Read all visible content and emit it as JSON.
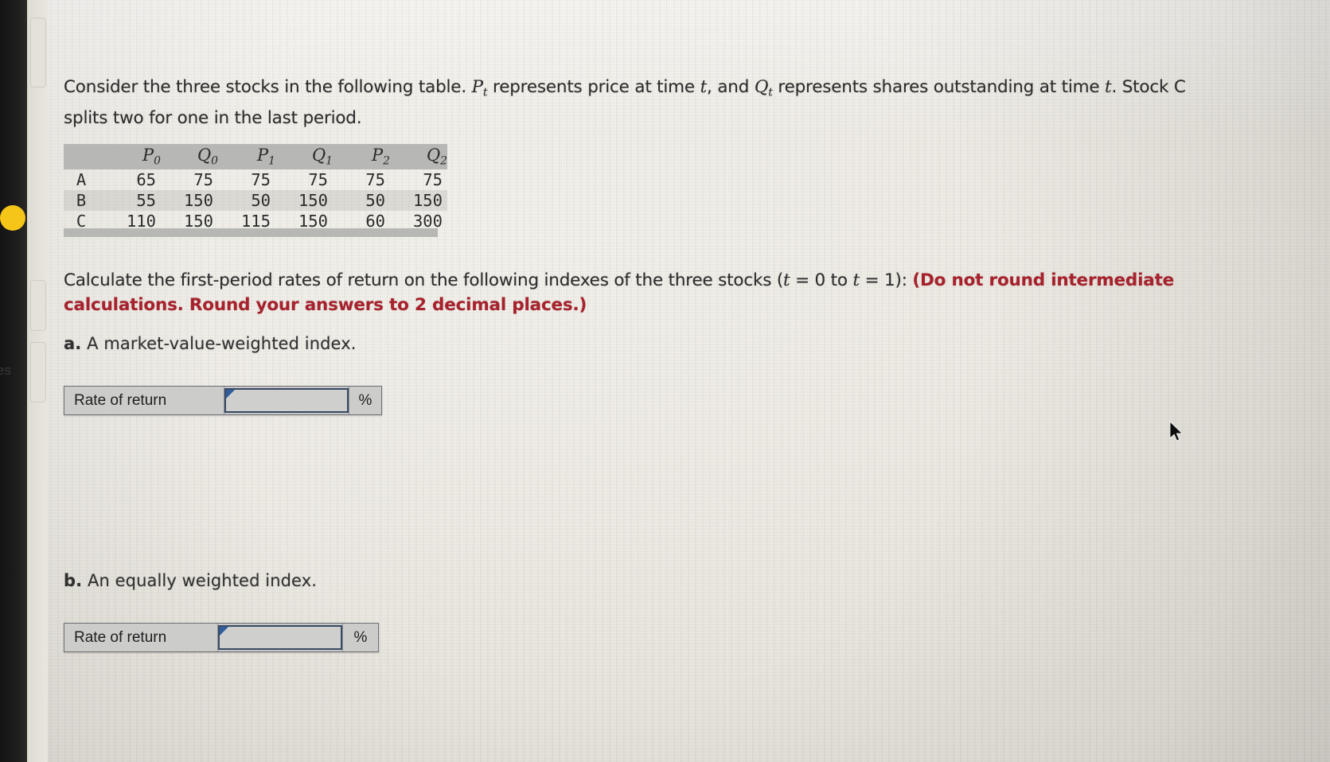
{
  "problem": {
    "intro_part1": "Consider the three stocks in the following table. ",
    "intro_var_P": "P",
    "intro_sub_t1": "t",
    "intro_part2": " represents price at time ",
    "intro_var_t1": "t",
    "intro_part3": ", and ",
    "intro_var_Q": "Q",
    "intro_sub_t2": "t",
    "intro_part4": " represents shares outstanding at time ",
    "intro_var_t2": "t",
    "intro_part5": ". Stock C splits two for one in the last period."
  },
  "table": {
    "corner_header": "",
    "headers": [
      {
        "base": "P",
        "sub": "0"
      },
      {
        "base": "Q",
        "sub": "0"
      },
      {
        "base": "P",
        "sub": "1"
      },
      {
        "base": "Q",
        "sub": "1"
      },
      {
        "base": "P",
        "sub": "2"
      },
      {
        "base": "Q",
        "sub": "2"
      }
    ],
    "rows": [
      {
        "label": "A",
        "values": [
          "65",
          "75",
          "75",
          "75",
          "75",
          "75"
        ]
      },
      {
        "label": "B",
        "values": [
          "55",
          "150",
          "50",
          "150",
          "50",
          "150"
        ]
      },
      {
        "label": "C",
        "values": [
          "110",
          "150",
          "115",
          "150",
          "60",
          "300"
        ]
      }
    ]
  },
  "instruction": {
    "lead": "Calculate the first-period rates of return on the following indexes of the three stocks (",
    "var_t_a": "t",
    "eq_a": " = 0 to ",
    "var_t_b": "t",
    "eq_b": " = 1): ",
    "emphasis": "(Do not round intermediate calculations. Round your answers to 2 decimal places.)"
  },
  "parts": [
    {
      "letter": "a.",
      "text": " A market-value-weighted index.",
      "field": {
        "label": "Rate of return",
        "value": "",
        "placeholder": "",
        "unit": "%"
      }
    },
    {
      "letter": "b.",
      "text": " An equally weighted index.",
      "field": {
        "label": "Rate of return",
        "value": "",
        "placeholder": "",
        "unit": "%"
      }
    }
  ],
  "chrome": {
    "side_tab_text": "es"
  },
  "colors": {
    "emphasis_red": "#a8212c",
    "table_header_gray": "#b7b8b5",
    "input_border_blue": "#394a63",
    "flag_blue": "#2f5d9e",
    "accent_yellow": "#f5c518",
    "body_text": "#2c2c2c"
  }
}
